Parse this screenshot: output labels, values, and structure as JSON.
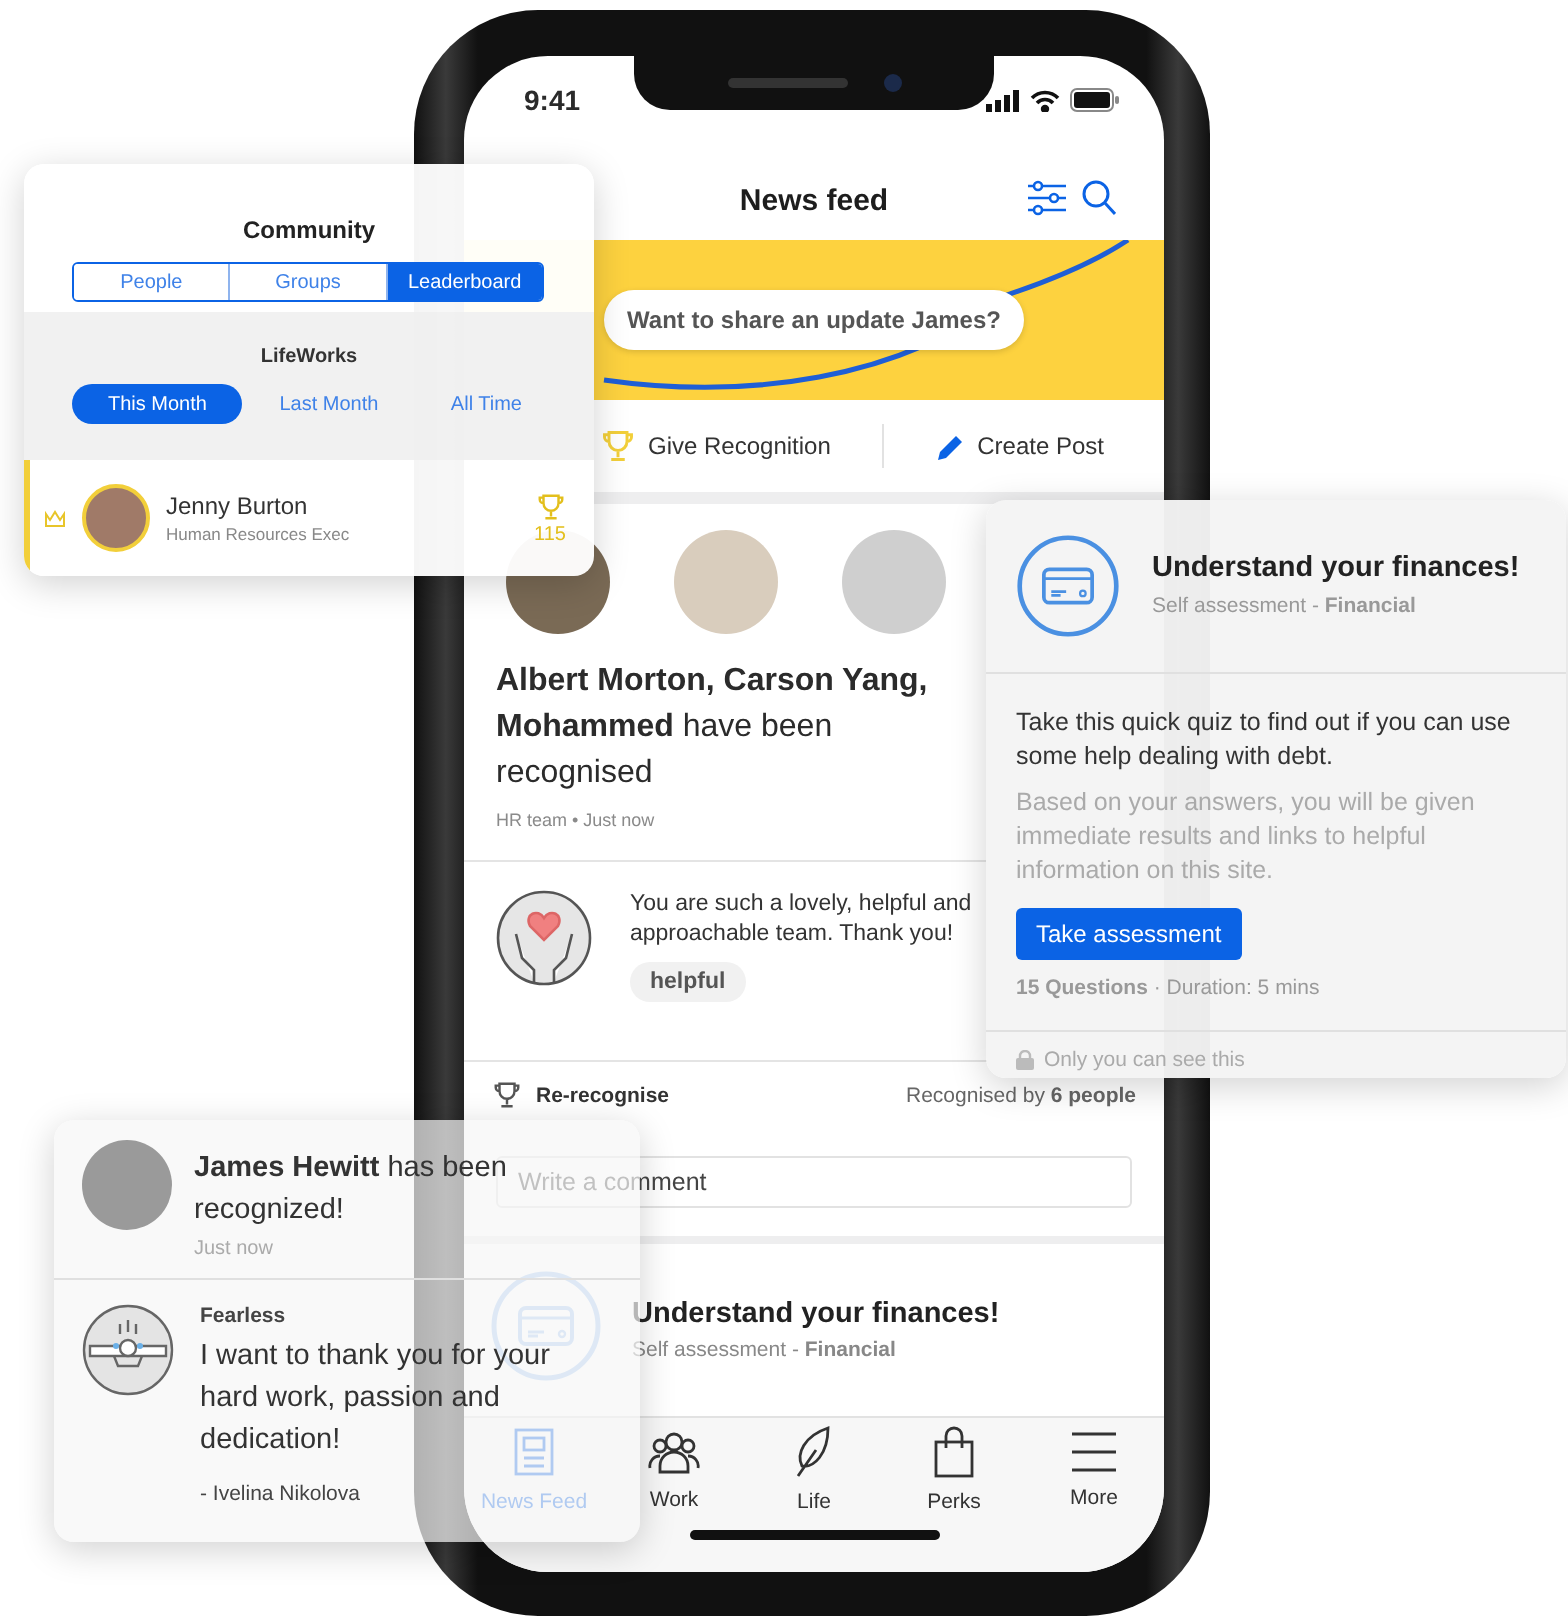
{
  "status_bar": {
    "time": "9:41"
  },
  "header": {
    "title": "News feed"
  },
  "share_prompt": "Want to share an update James?",
  "actions": [
    {
      "label": "Give Recognition",
      "kind": "trophy"
    },
    {
      "label": "Create Post",
      "kind": "pencil"
    }
  ],
  "recognition_post": {
    "headline": "**Albert Morton, Carson Yang, Mohammed**  have been recognised",
    "meta": "HR team • Just now",
    "message": "You are such a lovely, helpful and approachable team. Thank you!",
    "tags": [
      "helpful"
    ],
    "re_recognise": "Re-recognise",
    "recognised_by": "Recognised by **6 people**",
    "comment": {
      "placeholder": "Write a comment"
    }
  },
  "assessment_post": {
    "title": "Understand your finances!",
    "subtitle": "Self assessment - **Financial**"
  },
  "tab_bar": [
    {
      "label": "News Feed",
      "kind": "newspaper",
      "selected": true
    },
    {
      "label": "Work",
      "kind": "people",
      "selected": false
    },
    {
      "label": "Life",
      "kind": "leaf",
      "selected": false
    },
    {
      "label": "Perks",
      "kind": "bag",
      "selected": false
    },
    {
      "label": "More",
      "kind": "menu",
      "selected": false
    }
  ],
  "community_card": {
    "title": "Community",
    "tabs": [
      {
        "label": "People",
        "selected": false
      },
      {
        "label": "Groups",
        "selected": false
      },
      {
        "label": "Leaderboard",
        "selected": true
      }
    ],
    "organization": "LifeWorks",
    "periods": [
      {
        "label": "This Month",
        "selected": true
      },
      {
        "label": "Last Month",
        "selected": false
      },
      {
        "label": "All Time",
        "selected": false
      }
    ],
    "leaders": [
      {
        "name": "Jenny Burton",
        "role": "Human Resources Exec",
        "score": "115"
      }
    ]
  },
  "assessment_card": {
    "title": "Understand your finances!",
    "subtitle": "Self assessment - **Financial**",
    "description": "Take this quick quiz to find out if you can use some help dealing with debt.",
    "details": "Based on your answers, you will be given immediate results and links to helpful information on this site.",
    "button": "Take assessment",
    "stats": "**15 Questions** · Duration: 5 mins",
    "privacy": "Only you can see this"
  },
  "notification_card": {
    "headline": "**James Hewitt** has been recognized!",
    "time": "Just now",
    "badge": "Fearless",
    "quote": "I want to thank you for your hard work, passion and dedication!",
    "author": "- Ivelina Nikolova"
  }
}
